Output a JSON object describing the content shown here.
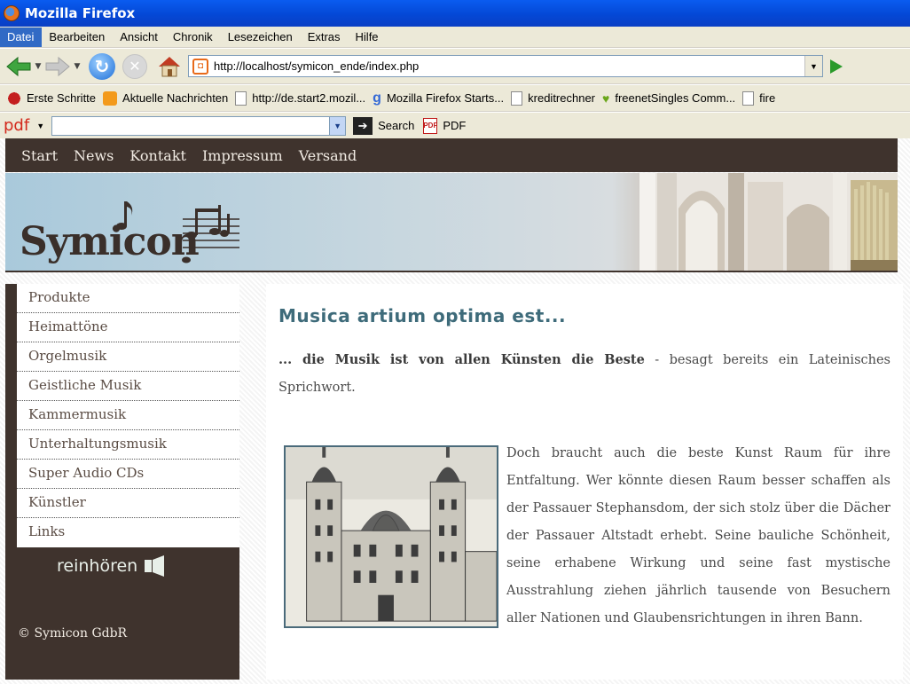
{
  "browser": {
    "title": "Mozilla Firefox",
    "menu": [
      "Datei",
      "Bearbeiten",
      "Ansicht",
      "Chronik",
      "Lesezeichen",
      "Extras",
      "Hilfe"
    ],
    "url": "http://localhost/symicon_ende/index.php",
    "bookmarks": [
      "Erste Schritte",
      "Aktuelle Nachrichten",
      "http://de.start2.mozil...",
      "Mozilla Firefox Starts...",
      "kreditrechner",
      "freenetSingles Comm...",
      "fire"
    ],
    "pdf_toolbar": {
      "logo": "pdf",
      "search_label": "Search",
      "pdf_label": "PDF",
      "search_value": ""
    }
  },
  "site": {
    "topnav": [
      "Start",
      "News",
      "Kontakt",
      "Impressum",
      "Versand"
    ],
    "logo_text": "Symicon",
    "sidebar": [
      "Produkte",
      "Heimattöne",
      "Orgelmusik",
      "Geistliche Musik",
      "Kammermusik",
      "Unterhaltungsmusik",
      "Super Audio CDs",
      "Künstler",
      "Links"
    ],
    "reinhoeren": "reinhören",
    "copyright": "© Symicon GdbR",
    "content": {
      "heading": "Musica artium optima est...",
      "para1_bold": "... die Musik ist von allen Künsten die Beste",
      "para1_rest": " - besagt bereits ein Lateinisches Sprichwort.",
      "para2": "Doch braucht auch die beste Kunst Raum für ihre Entfaltung. Wer könnte diesen Raum besser schaffen als der Passauer Stephansdom, der sich stolz über die Dächer der Passauer Altstadt erhebt. Seine bauliche Schönheit, seine erhabene Wirkung und seine fast mystische Ausstrahlung ziehen jährlich tausende von Besuchern aller Nationen und Glaubensrichtungen in ihren Bann."
    }
  },
  "colors": {
    "titlebar": "#0448d6",
    "site_dark": "#3f332d",
    "heading": "#3e6b7a"
  }
}
